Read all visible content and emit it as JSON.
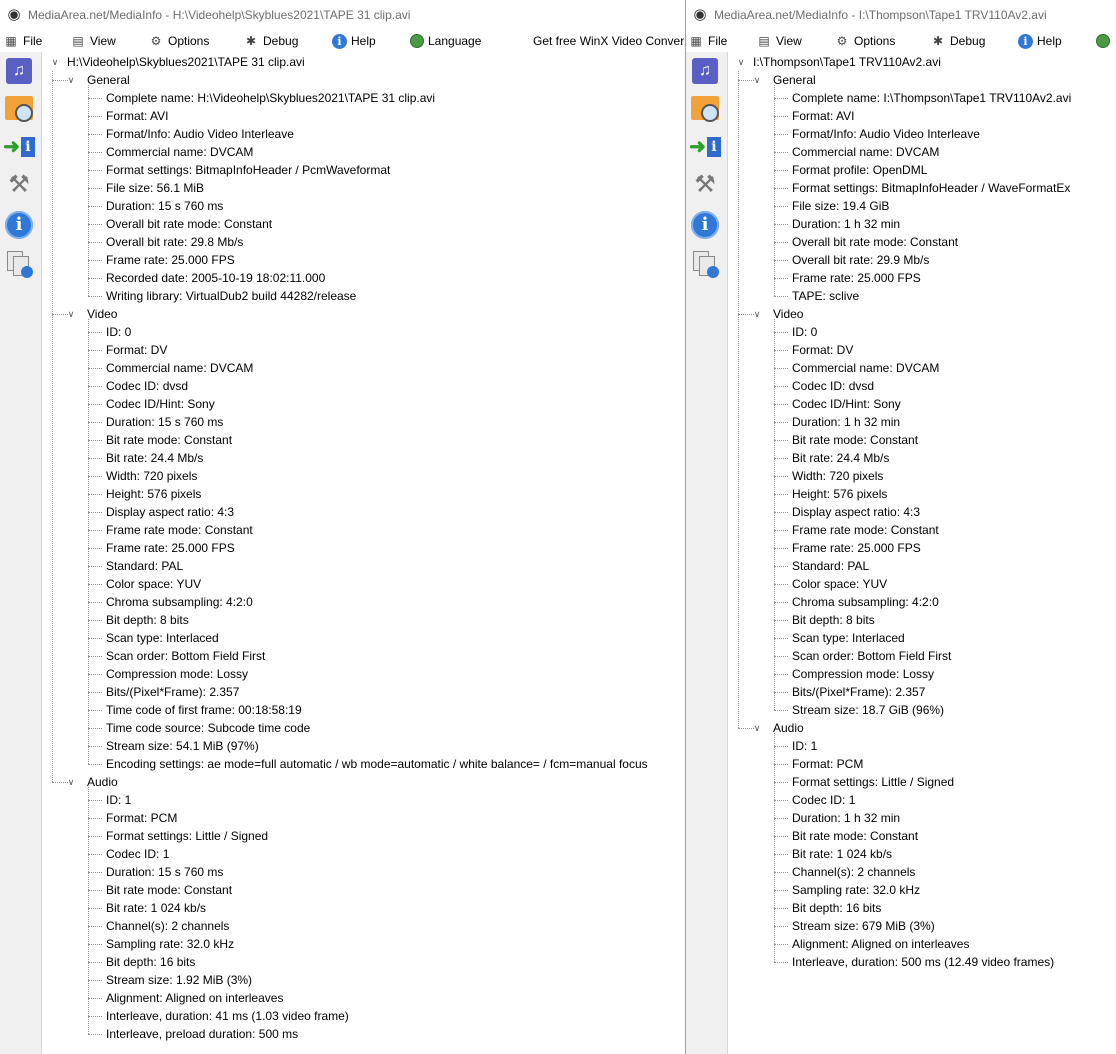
{
  "left": {
    "title": "MediaArea.net/MediaInfo - H:\\Videohelp\\Skyblues2021\\TAPE 31 clip.avi",
    "menu": {
      "file": "File",
      "view": "View",
      "options": "Options",
      "debug": "Debug",
      "help": "Help",
      "language": "Language",
      "promo": "Get free WinX Video Convert"
    },
    "root": "H:\\Videohelp\\Skyblues2021\\TAPE 31 clip.avi",
    "sections": [
      {
        "name": "General",
        "items": [
          "Complete name: H:\\Videohelp\\Skyblues2021\\TAPE 31 clip.avi",
          "Format: AVI",
          "Format/Info: Audio Video Interleave",
          "Commercial name: DVCAM",
          "Format settings: BitmapInfoHeader / PcmWaveformat",
          "File size: 56.1 MiB",
          "Duration: 15 s 760 ms",
          "Overall bit rate mode: Constant",
          "Overall bit rate: 29.8 Mb/s",
          "Frame rate: 25.000 FPS",
          "Recorded date: 2005-10-19 18:02:11.000",
          "Writing library: VirtualDub2 build 44282/release"
        ]
      },
      {
        "name": "Video",
        "items": [
          "ID: 0",
          "Format: DV",
          "Commercial name: DVCAM",
          "Codec ID: dvsd",
          "Codec ID/Hint: Sony",
          "Duration: 15 s 760 ms",
          "Bit rate mode: Constant",
          "Bit rate: 24.4 Mb/s",
          "Width: 720 pixels",
          "Height: 576 pixels",
          "Display aspect ratio: 4:3",
          "Frame rate mode: Constant",
          "Frame rate: 25.000 FPS",
          "Standard: PAL",
          "Color space: YUV",
          "Chroma subsampling: 4:2:0",
          "Bit depth: 8 bits",
          "Scan type: Interlaced",
          "Scan order: Bottom Field First",
          "Compression mode: Lossy",
          "Bits/(Pixel*Frame): 2.357",
          "Time code of first frame: 00:18:58:19",
          "Time code source: Subcode time code",
          "Stream size: 54.1 MiB (97%)",
          "Encoding settings: ae mode=full automatic / wb mode=automatic / white balance= / fcm=manual focus"
        ]
      },
      {
        "name": "Audio",
        "items": [
          "ID: 1",
          "Format: PCM",
          "Format settings: Little / Signed",
          "Codec ID: 1",
          "Duration: 15 s 760 ms",
          "Bit rate mode: Constant",
          "Bit rate: 1 024 kb/s",
          "Channel(s): 2 channels",
          "Sampling rate: 32.0 kHz",
          "Bit depth: 16 bits",
          "Stream size: 1.92 MiB (3%)",
          "Alignment: Aligned on interleaves",
          "Interleave, duration: 41  ms (1.03 video frame)",
          "Interleave, preload duration: 500  ms"
        ]
      }
    ]
  },
  "right": {
    "title": "MediaArea.net/MediaInfo - I:\\Thompson\\Tape1 TRV110Av2.avi",
    "menu": {
      "file": "File",
      "view": "View",
      "options": "Options",
      "debug": "Debug",
      "help": "Help"
    },
    "root": "I:\\Thompson\\Tape1 TRV110Av2.avi",
    "sections": [
      {
        "name": "General",
        "items": [
          "Complete name: I:\\Thompson\\Tape1 TRV110Av2.avi",
          "Format: AVI",
          "Format/Info: Audio Video Interleave",
          "Commercial name: DVCAM",
          "Format profile: OpenDML",
          "Format settings: BitmapInfoHeader / WaveFormatEx",
          "File size: 19.4 GiB",
          "Duration: 1 h 32 min",
          "Overall bit rate mode: Constant",
          "Overall bit rate: 29.9 Mb/s",
          "Frame rate: 25.000 FPS",
          "TAPE: sclive"
        ]
      },
      {
        "name": "Video",
        "items": [
          "ID: 0",
          "Format: DV",
          "Commercial name: DVCAM",
          "Codec ID: dvsd",
          "Codec ID/Hint: Sony",
          "Duration: 1 h 32 min",
          "Bit rate mode: Constant",
          "Bit rate: 24.4 Mb/s",
          "Width: 720 pixels",
          "Height: 576 pixels",
          "Display aspect ratio: 4:3",
          "Frame rate mode: Constant",
          "Frame rate: 25.000 FPS",
          "Standard: PAL",
          "Color space: YUV",
          "Chroma subsampling: 4:2:0",
          "Bit depth: 8 bits",
          "Scan type: Interlaced",
          "Scan order: Bottom Field First",
          "Compression mode: Lossy",
          "Bits/(Pixel*Frame): 2.357",
          "Stream size: 18.7 GiB (96%)"
        ]
      },
      {
        "name": "Audio",
        "items": [
          "ID: 1",
          "Format: PCM",
          "Format settings: Little / Signed",
          "Codec ID: 1",
          "Duration: 1 h 32 min",
          "Bit rate mode: Constant",
          "Bit rate: 1 024 kb/s",
          "Channel(s): 2 channels",
          "Sampling rate: 32.0 kHz",
          "Bit depth: 16 bits",
          "Stream size: 679 MiB (3%)",
          "Alignment: Aligned on interleaves",
          "Interleave, duration: 500  ms (12.49 video frames)"
        ]
      }
    ]
  }
}
